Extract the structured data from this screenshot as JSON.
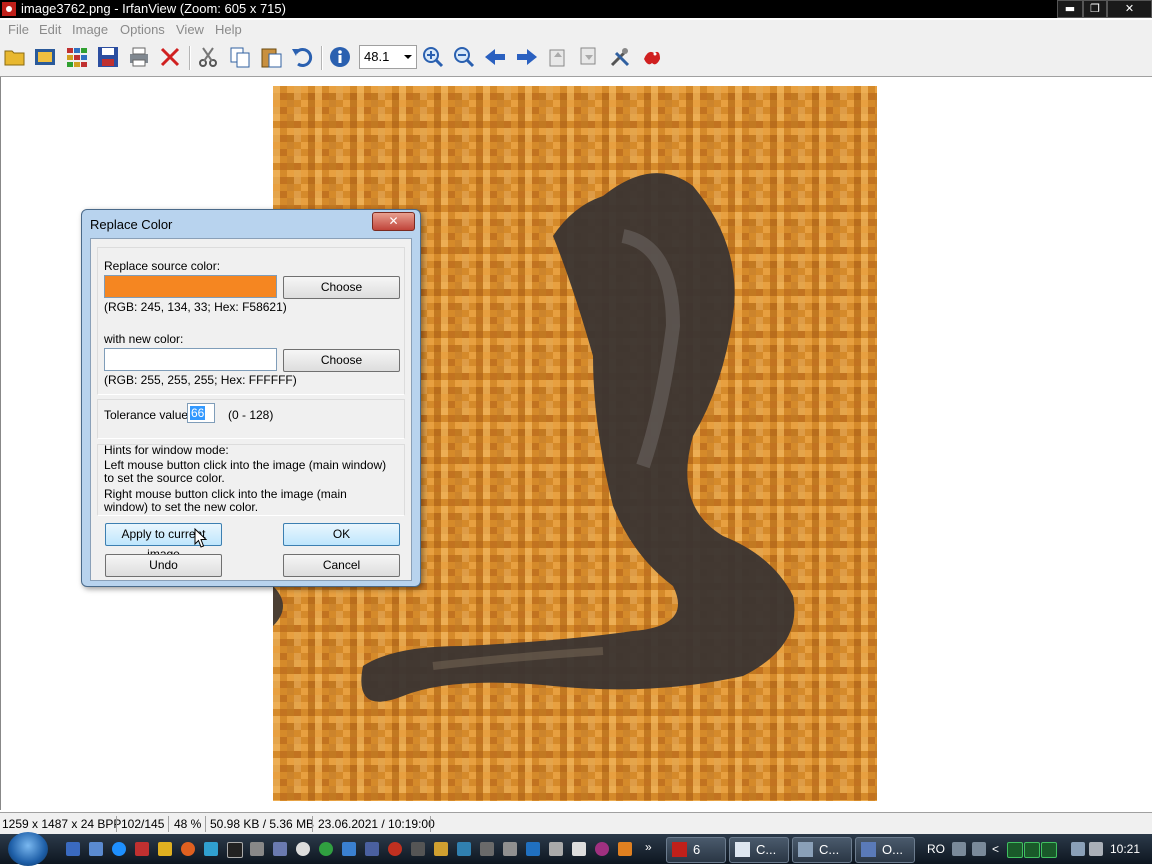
{
  "window": {
    "title": "image3762.png - IrfanView (Zoom: 605 x 715)",
    "min_label": "▬",
    "max_label": "❐",
    "close_label": "✕"
  },
  "menu": {
    "items": [
      "File",
      "Edit",
      "Image",
      "Options",
      "View",
      "Help"
    ]
  },
  "toolbar": {
    "zoom_value": "48.1",
    "icons": [
      "open-icon",
      "slideshow-icon",
      "thumbnails-icon",
      "save-icon",
      "print-icon",
      "delete-icon",
      "cut-icon",
      "copy-icon",
      "paste-icon",
      "undo-icon",
      "info-icon",
      "zoom-in-icon",
      "zoom-out-icon",
      "previous-icon",
      "next-icon",
      "first-page-icon",
      "last-page-icon",
      "settings-icon",
      "irfanview-logo-icon"
    ]
  },
  "status": {
    "dimensions": "1259 x 1487 x 24 BPP",
    "position": "102/145",
    "zoom": "48 %",
    "size": "50.98 KB / 5.36 MB",
    "datetime": "23.06.2021 / 10:19:00"
  },
  "dialog": {
    "title": "Replace Color",
    "close_label": "✕",
    "source_label": "Replace source color:",
    "source_color": "#F58621",
    "source_info": "(RGB: 245, 134, 33; Hex: F58621)",
    "new_label": "with new color:",
    "new_color": "#FFFFFF",
    "new_info": "(RGB: 255, 255, 255; Hex: FFFFFF)",
    "choose_label": "Choose",
    "tolerance_label": "Tolerance value:",
    "tolerance_value": "66",
    "tolerance_range": "(0 - 128)",
    "hints_title": "Hints for window mode:",
    "hint1": "Left mouse button click into the image (main window) to set the source color.",
    "hint2": "Right mouse button click into the image (main window) to set the new color.",
    "apply_label": "Apply to current image",
    "ok_label": "OK",
    "undo_label": "Undo",
    "cancel_label": "Cancel"
  },
  "taskbar": {
    "tasks": [
      {
        "label": "6",
        "icon": "irfanview-icon"
      },
      {
        "label": "C...",
        "icon": "notepad-icon"
      },
      {
        "label": "C...",
        "icon": "app-icon"
      },
      {
        "label": "O...",
        "icon": "window-icon"
      }
    ],
    "language": "RO",
    "clock": "10:21"
  },
  "colors": {
    "image_orange": "#d9892a",
    "image_dark": "#3a3432"
  }
}
